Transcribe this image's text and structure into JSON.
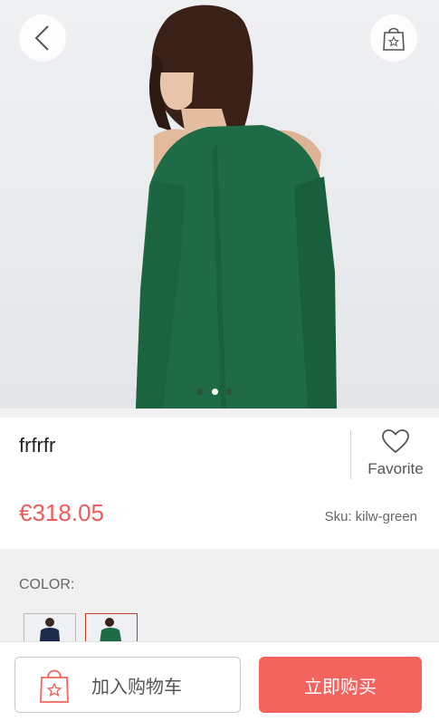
{
  "product": {
    "name": "frfrfr",
    "price": "€318.05",
    "sku_label": "Sku:",
    "sku_value": "kilw-green"
  },
  "favorite": {
    "label": "Favorite",
    "icon": "heart-icon"
  },
  "gallery": {
    "slide_count": 3,
    "active_slide": 2
  },
  "color": {
    "label": "COLOR:",
    "options": [
      "navy",
      "green"
    ],
    "selected": "green"
  },
  "actions": {
    "add_to_cart": "加入购物车",
    "buy_now": "立即购买"
  },
  "colors": {
    "accent": "#f4645f",
    "price": "#f05a5a",
    "garment": "#1f6b45"
  }
}
